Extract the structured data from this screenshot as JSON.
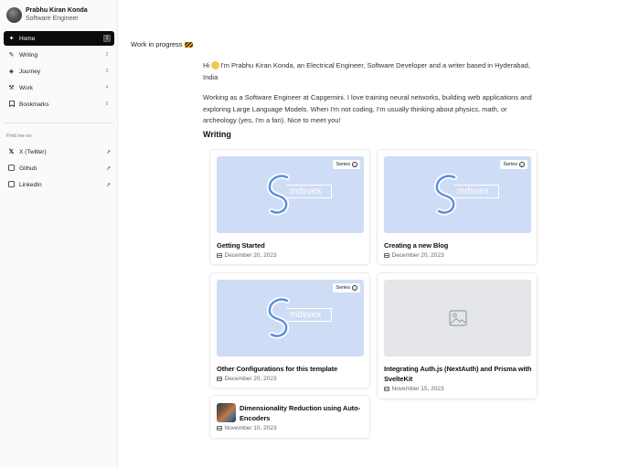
{
  "profile": {
    "name": "Prabhu Kiran Konda",
    "role": "Software Engineer"
  },
  "nav": [
    {
      "label": "Home",
      "key": "1",
      "icon": "sparkle-icon",
      "active": true
    },
    {
      "label": "Writing",
      "key": "2",
      "icon": "pen-icon",
      "active": false
    },
    {
      "label": "Journey",
      "key": "3",
      "icon": "compass-icon",
      "active": false
    },
    {
      "label": "Work",
      "key": "4",
      "icon": "hammer-icon",
      "active": false
    },
    {
      "label": "Bookmarks",
      "key": "5",
      "icon": "bookmark-icon",
      "active": false
    }
  ],
  "find_me": {
    "label": "Find me on",
    "links": [
      {
        "label": "X (Twitter)",
        "icon": "x-icon"
      },
      {
        "label": "Github",
        "icon": "github-icon"
      },
      {
        "label": "LinkedIn",
        "icon": "linkedin-icon"
      }
    ]
  },
  "main": {
    "wip": "Work in progress",
    "intro_1": "I'm Prabhu Kiran Konda, an Electrical Engineer, Software Developer and a writer based in Hyderabad, India",
    "intro_hi": "Hi",
    "intro_2": "Working as a Software Engineer at Capgemini. I love training neural networks, building web applications and exploring Large Language Models. When I'm not coding, I'm usually thinking about physics, math, or archeology (yes, I'm a fan). Nice to meet you!",
    "section_title": "Writing"
  },
  "posts": [
    {
      "title": "Getting Started",
      "date": "December 20, 2023",
      "badge": "Series",
      "logo_text": "mdsvex"
    },
    {
      "title": "Creating a new Blog",
      "date": "December 20, 2023",
      "badge": "Series",
      "logo_text": "mdsvex"
    },
    {
      "title": "Other Configurations for this template",
      "date": "December 20, 2023",
      "badge": "Series",
      "logo_text": "mdsvex"
    },
    {
      "title": "Integrating Auth.js (NextAuth) and Prisma with SvelteKit",
      "date": "November 15, 2023"
    },
    {
      "title": "Dimensionality Reduction using Auto-Encoders",
      "date": "November 10, 2023"
    }
  ],
  "colors": {
    "accent": "#0b0b0b",
    "thumb_bg": "#cfdcf5",
    "placeholder_bg": "#e4e6e9"
  }
}
